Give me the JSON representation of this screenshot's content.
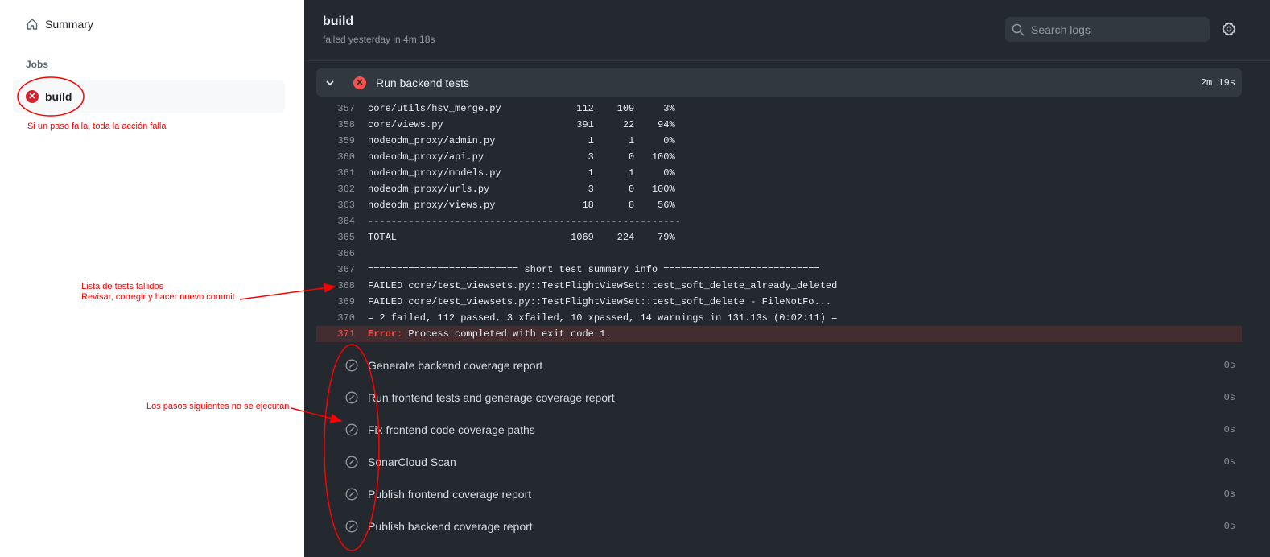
{
  "sidebar": {
    "summary": "Summary",
    "jobs_label": "Jobs",
    "job": {
      "name": "build",
      "status": "failed"
    }
  },
  "header": {
    "title": "build",
    "subtitle": "failed yesterday in 4m 18s",
    "search_placeholder": "Search logs"
  },
  "current_step": {
    "name": "Run backend tests",
    "duration": "2m 19s",
    "status": "failed"
  },
  "log_lines": [
    {
      "n": "357",
      "text": "core/utils/hsv_merge.py             112    109     3%"
    },
    {
      "n": "358",
      "text": "core/views.py                       391     22    94%"
    },
    {
      "n": "359",
      "text": "nodeodm_proxy/admin.py                1      1     0%"
    },
    {
      "n": "360",
      "text": "nodeodm_proxy/api.py                  3      0   100%"
    },
    {
      "n": "361",
      "text": "nodeodm_proxy/models.py               1      1     0%"
    },
    {
      "n": "362",
      "text": "nodeodm_proxy/urls.py                 3      0   100%"
    },
    {
      "n": "363",
      "text": "nodeodm_proxy/views.py               18      8    56%"
    },
    {
      "n": "364",
      "text": "------------------------------------------------------"
    },
    {
      "n": "365",
      "text": "TOTAL                              1069    224    79%"
    },
    {
      "n": "366",
      "text": ""
    },
    {
      "n": "367",
      "text": "========================== short test summary info ==========================="
    },
    {
      "n": "368",
      "text": "FAILED core/test_viewsets.py::TestFlightViewSet::test_soft_delete_already_deleted"
    },
    {
      "n": "369",
      "text": "FAILED core/test_viewsets.py::TestFlightViewSet::test_soft_delete - FileNotFo..."
    },
    {
      "n": "370",
      "text": "= 2 failed, 112 passed, 3 xfailed, 10 xpassed, 14 warnings in 131.13s (0:02:11) ="
    }
  ],
  "error_line": {
    "n": "371",
    "prefix": "Error:",
    "text": " Process completed with exit code 1."
  },
  "skipped_steps": [
    {
      "name": "Generate backend coverage report",
      "duration": "0s"
    },
    {
      "name": "Run frontend tests and generage coverage report",
      "duration": "0s"
    },
    {
      "name": "Fix frontend code coverage paths",
      "duration": "0s"
    },
    {
      "name": "SonarCloud Scan",
      "duration": "0s"
    },
    {
      "name": "Publish frontend coverage report",
      "duration": "0s"
    },
    {
      "name": "Publish backend coverage report",
      "duration": "0s"
    }
  ],
  "annotations": {
    "job_note": "Si un paso falla, toda la acción falla",
    "failed_list_line1": "Lista de tests fallidos",
    "failed_list_line2": "Revisar, corregir y hacer nuevo commit",
    "skipped_note": "Los pasos siguientes no se ejecutan",
    "color": "#ff0000"
  }
}
